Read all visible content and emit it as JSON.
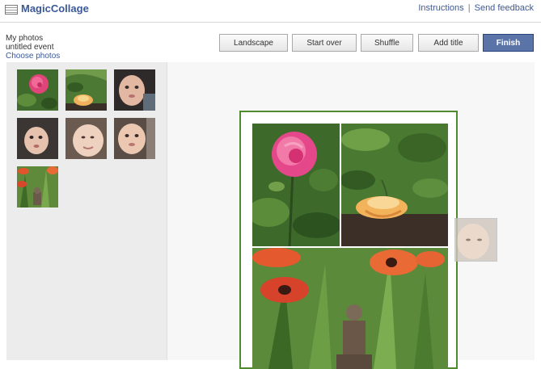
{
  "header": {
    "title": "MagicCollage",
    "links": {
      "instructions": "Instructions",
      "separator": "|",
      "feedback": "Send feedback"
    }
  },
  "info": {
    "album": "My photos",
    "event": "untitled event",
    "choose": "Choose photos"
  },
  "toolbar": {
    "landscape": "Landscape",
    "start_over": "Start over",
    "shuffle": "Shuffle",
    "add_title": "Add title",
    "finish": "Finish"
  },
  "colors": {
    "brand": "#3b5998",
    "finish_button": "#5b74a8",
    "collage_border": "#4f8a2d"
  },
  "tray": {
    "photos": [
      "pink-rose",
      "yellow-rose",
      "baby-portrait",
      "baby-portrait",
      "baby-portrait",
      "baby-portrait",
      "poppies-buddha"
    ]
  }
}
